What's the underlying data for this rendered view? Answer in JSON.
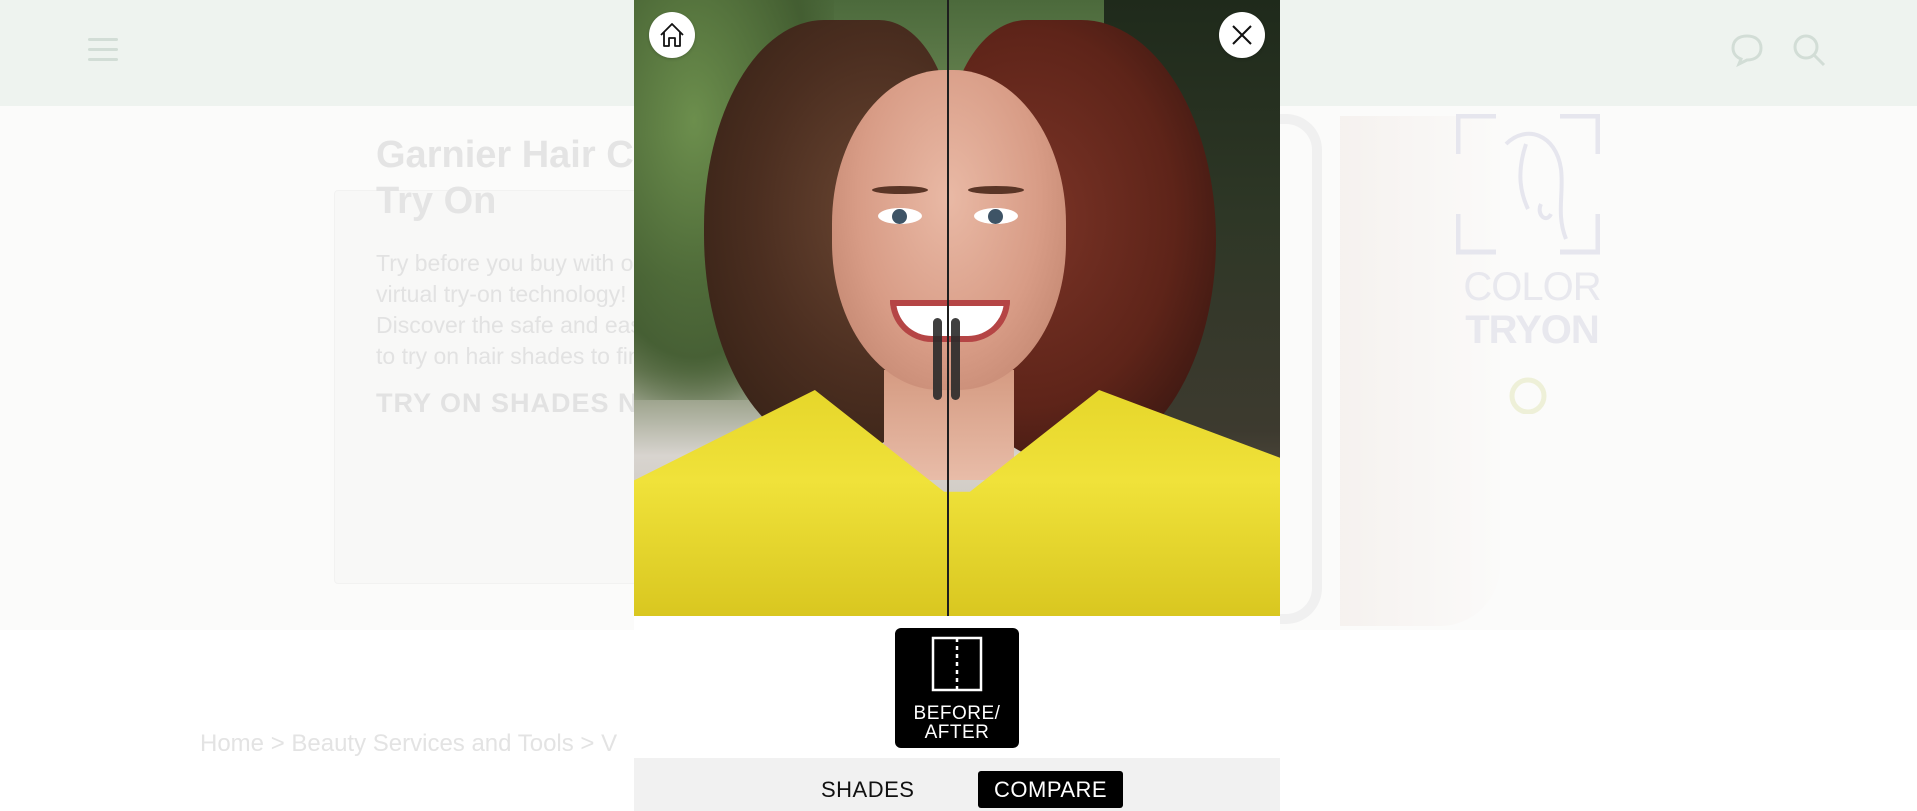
{
  "background_page": {
    "hero": {
      "title": "Garnier Hair Color Try On",
      "description": "Try before you buy with our virtual try-on technology! Discover the safe and easy way to try on hair shades to find the",
      "cta": "TRY ON SHADES NOW"
    },
    "logo": {
      "line1": "COLOR",
      "line2": "TRYON"
    },
    "breadcrumb": "Home > Beauty Services and Tools > V"
  },
  "modal": {
    "compare_button_label": "BEFORE/ AFTER",
    "tabs": [
      {
        "label": "SHADES",
        "active": false
      },
      {
        "label": "COMPARE",
        "active": true
      }
    ],
    "compare_split": 0.485
  },
  "icons": {
    "menu": "hamburger-icon",
    "chat": "chat-icon",
    "search": "search-icon",
    "home": "home-icon",
    "close": "close-icon",
    "split": "split-view-icon"
  },
  "colors": {
    "header_bg": "#eef3ef",
    "accent": "#000000",
    "jacket": "#f0e23a"
  }
}
